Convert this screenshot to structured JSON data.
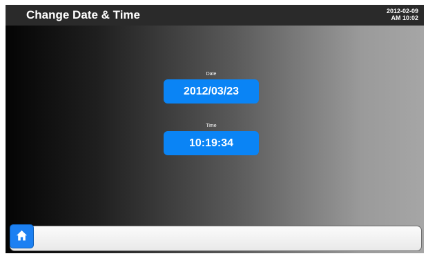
{
  "header": {
    "title": "Change Date & Time",
    "clock_date": "2012-02-09",
    "clock_time": "AM 10:02"
  },
  "date_field": {
    "label": "Date",
    "value": "2012/03/23"
  },
  "time_field": {
    "label": "Time",
    "value": "10:19:34"
  },
  "footer": {
    "home_icon": "home-icon"
  },
  "colors": {
    "header_bg": "#2a2a2a",
    "button_blue": "#0a84f5",
    "home_blue": "#1c80f2"
  }
}
